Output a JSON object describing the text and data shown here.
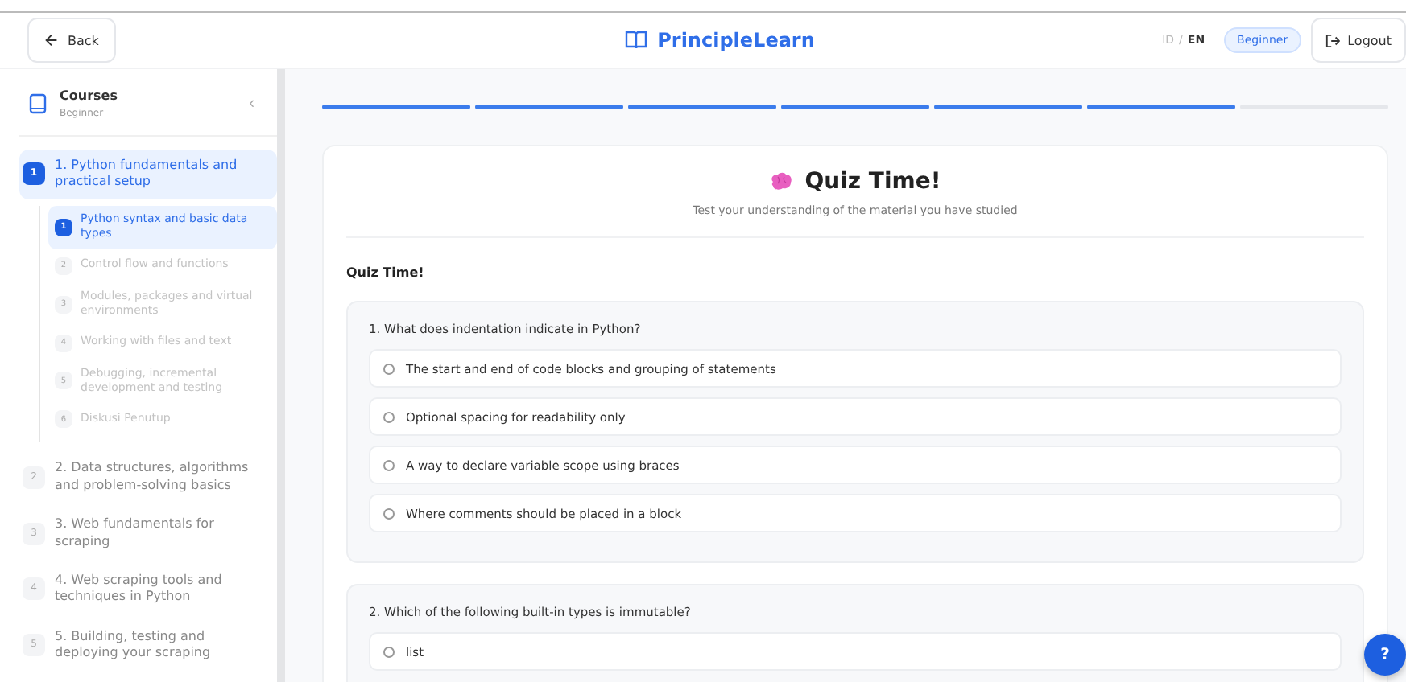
{
  "header": {
    "back_label": "Back",
    "brand": "PrincipleLearn",
    "lang_options": [
      {
        "label": "ID",
        "selected": false
      },
      {
        "label": "EN",
        "selected": true
      }
    ],
    "lang_separator": "/",
    "level_badge": "Beginner",
    "logout_label": "Logout"
  },
  "sidebar": {
    "title": "Courses",
    "subtitle": "Beginner",
    "collapse_glyph": "‹",
    "modules": [
      {
        "number": "1",
        "title": "1. Python fundamentals and practical setup",
        "selected": true,
        "expanded": true,
        "children": [
          {
            "number": "1",
            "title": "Python syntax and basic data types",
            "selected": true,
            "locked": false
          },
          {
            "number": "2",
            "title": "Control flow and functions",
            "selected": false,
            "locked": true
          },
          {
            "number": "3",
            "title": "Modules, packages and virtual environments",
            "selected": false,
            "locked": true
          },
          {
            "number": "4",
            "title": "Working with files and text",
            "selected": false,
            "locked": true
          },
          {
            "number": "5",
            "title": "Debugging, incremental development and testing",
            "selected": false,
            "locked": true
          },
          {
            "number": "6",
            "title": "Diskusi Penutup",
            "selected": false,
            "locked": true
          }
        ]
      },
      {
        "number": "2",
        "title": "2. Data structures, algorithms and problem-solving basics",
        "selected": false,
        "expanded": false
      },
      {
        "number": "3",
        "title": "3. Web fundamentals for scraping",
        "selected": false,
        "expanded": false
      },
      {
        "number": "4",
        "title": "4. Web scraping tools and techniques in Python",
        "selected": false,
        "expanded": false
      },
      {
        "number": "5",
        "title": "5. Building, testing and deploying your scraping",
        "selected": false,
        "expanded": false
      }
    ]
  },
  "progress_steps": [
    {
      "completed": true
    },
    {
      "completed": true
    },
    {
      "completed": true
    },
    {
      "completed": true
    },
    {
      "completed": true
    },
    {
      "completed": true
    },
    {
      "completed": false
    }
  ],
  "quiz": {
    "title": "Quiz Time!",
    "subtitle": "Test your understanding of the material you have studied",
    "section_title": "Quiz Time!",
    "questions": [
      {
        "question": "1. What does indentation indicate in Python?",
        "options": [
          {
            "label": "The start and end of code blocks and grouping of statements",
            "selected": false
          },
          {
            "label": "Optional spacing for readability only",
            "selected": false
          },
          {
            "label": "A way to declare variable scope using braces",
            "selected": false
          },
          {
            "label": "Where comments should be placed in a block",
            "selected": false
          }
        ]
      },
      {
        "question": "2. Which of the following built-in types is immutable?",
        "options": [
          {
            "label": "list",
            "selected": false
          }
        ]
      }
    ]
  },
  "help_button": "?"
}
